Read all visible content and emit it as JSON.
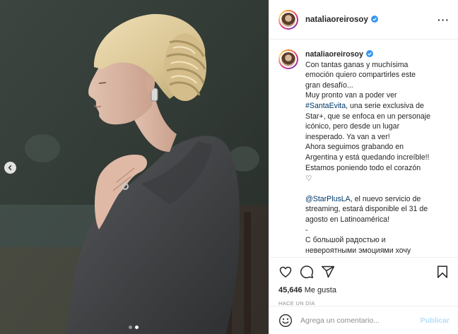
{
  "post": {
    "username": "nataliaoreirosoy",
    "more_icon": "ellipsis-icon",
    "caption": {
      "username": "nataliaoreirosoy",
      "line1": "Con tantas ganas y muchísima",
      "line2": "emoción quiero compartirles este",
      "line3": "gran desafío...",
      "line4": "Muy pronto van a poder ver",
      "hashtag": "#SantaEvita",
      "line5_rest": ", una serie exclusiva de",
      "line6": "Star+, que se enfoca en un personaje",
      "line7": "icónico, pero desde un lugar",
      "line8": "inesperado. Ya van a ver!",
      "line9": "Ahora seguimos grabando en",
      "line10": "Argentina y está quedando increíble!!",
      "line11": "Estamos poniendo todo el corazón",
      "heart": "♡",
      "mention": "@StarPlusLA",
      "line12_rest": ", el nuevo servicio de",
      "line13": "streaming, estará disponible el 31 de",
      "line14": "agosto en Latinoamérica!",
      "dash": "-",
      "line15": "С большой радостью и",
      "line16": "невероятными эмоциями хочу"
    },
    "likes_count": "45,646",
    "likes_label": "Me gusta",
    "timestamp": "HACE UN DÍA",
    "comment_placeholder": "Agrega un comentario...",
    "publish_label": "Publicar",
    "carousel": {
      "total": 2,
      "current": 2
    },
    "colors": {
      "verified": "#3897f0",
      "link": "#00376b",
      "publish_disabled": "#b2dffc"
    }
  }
}
